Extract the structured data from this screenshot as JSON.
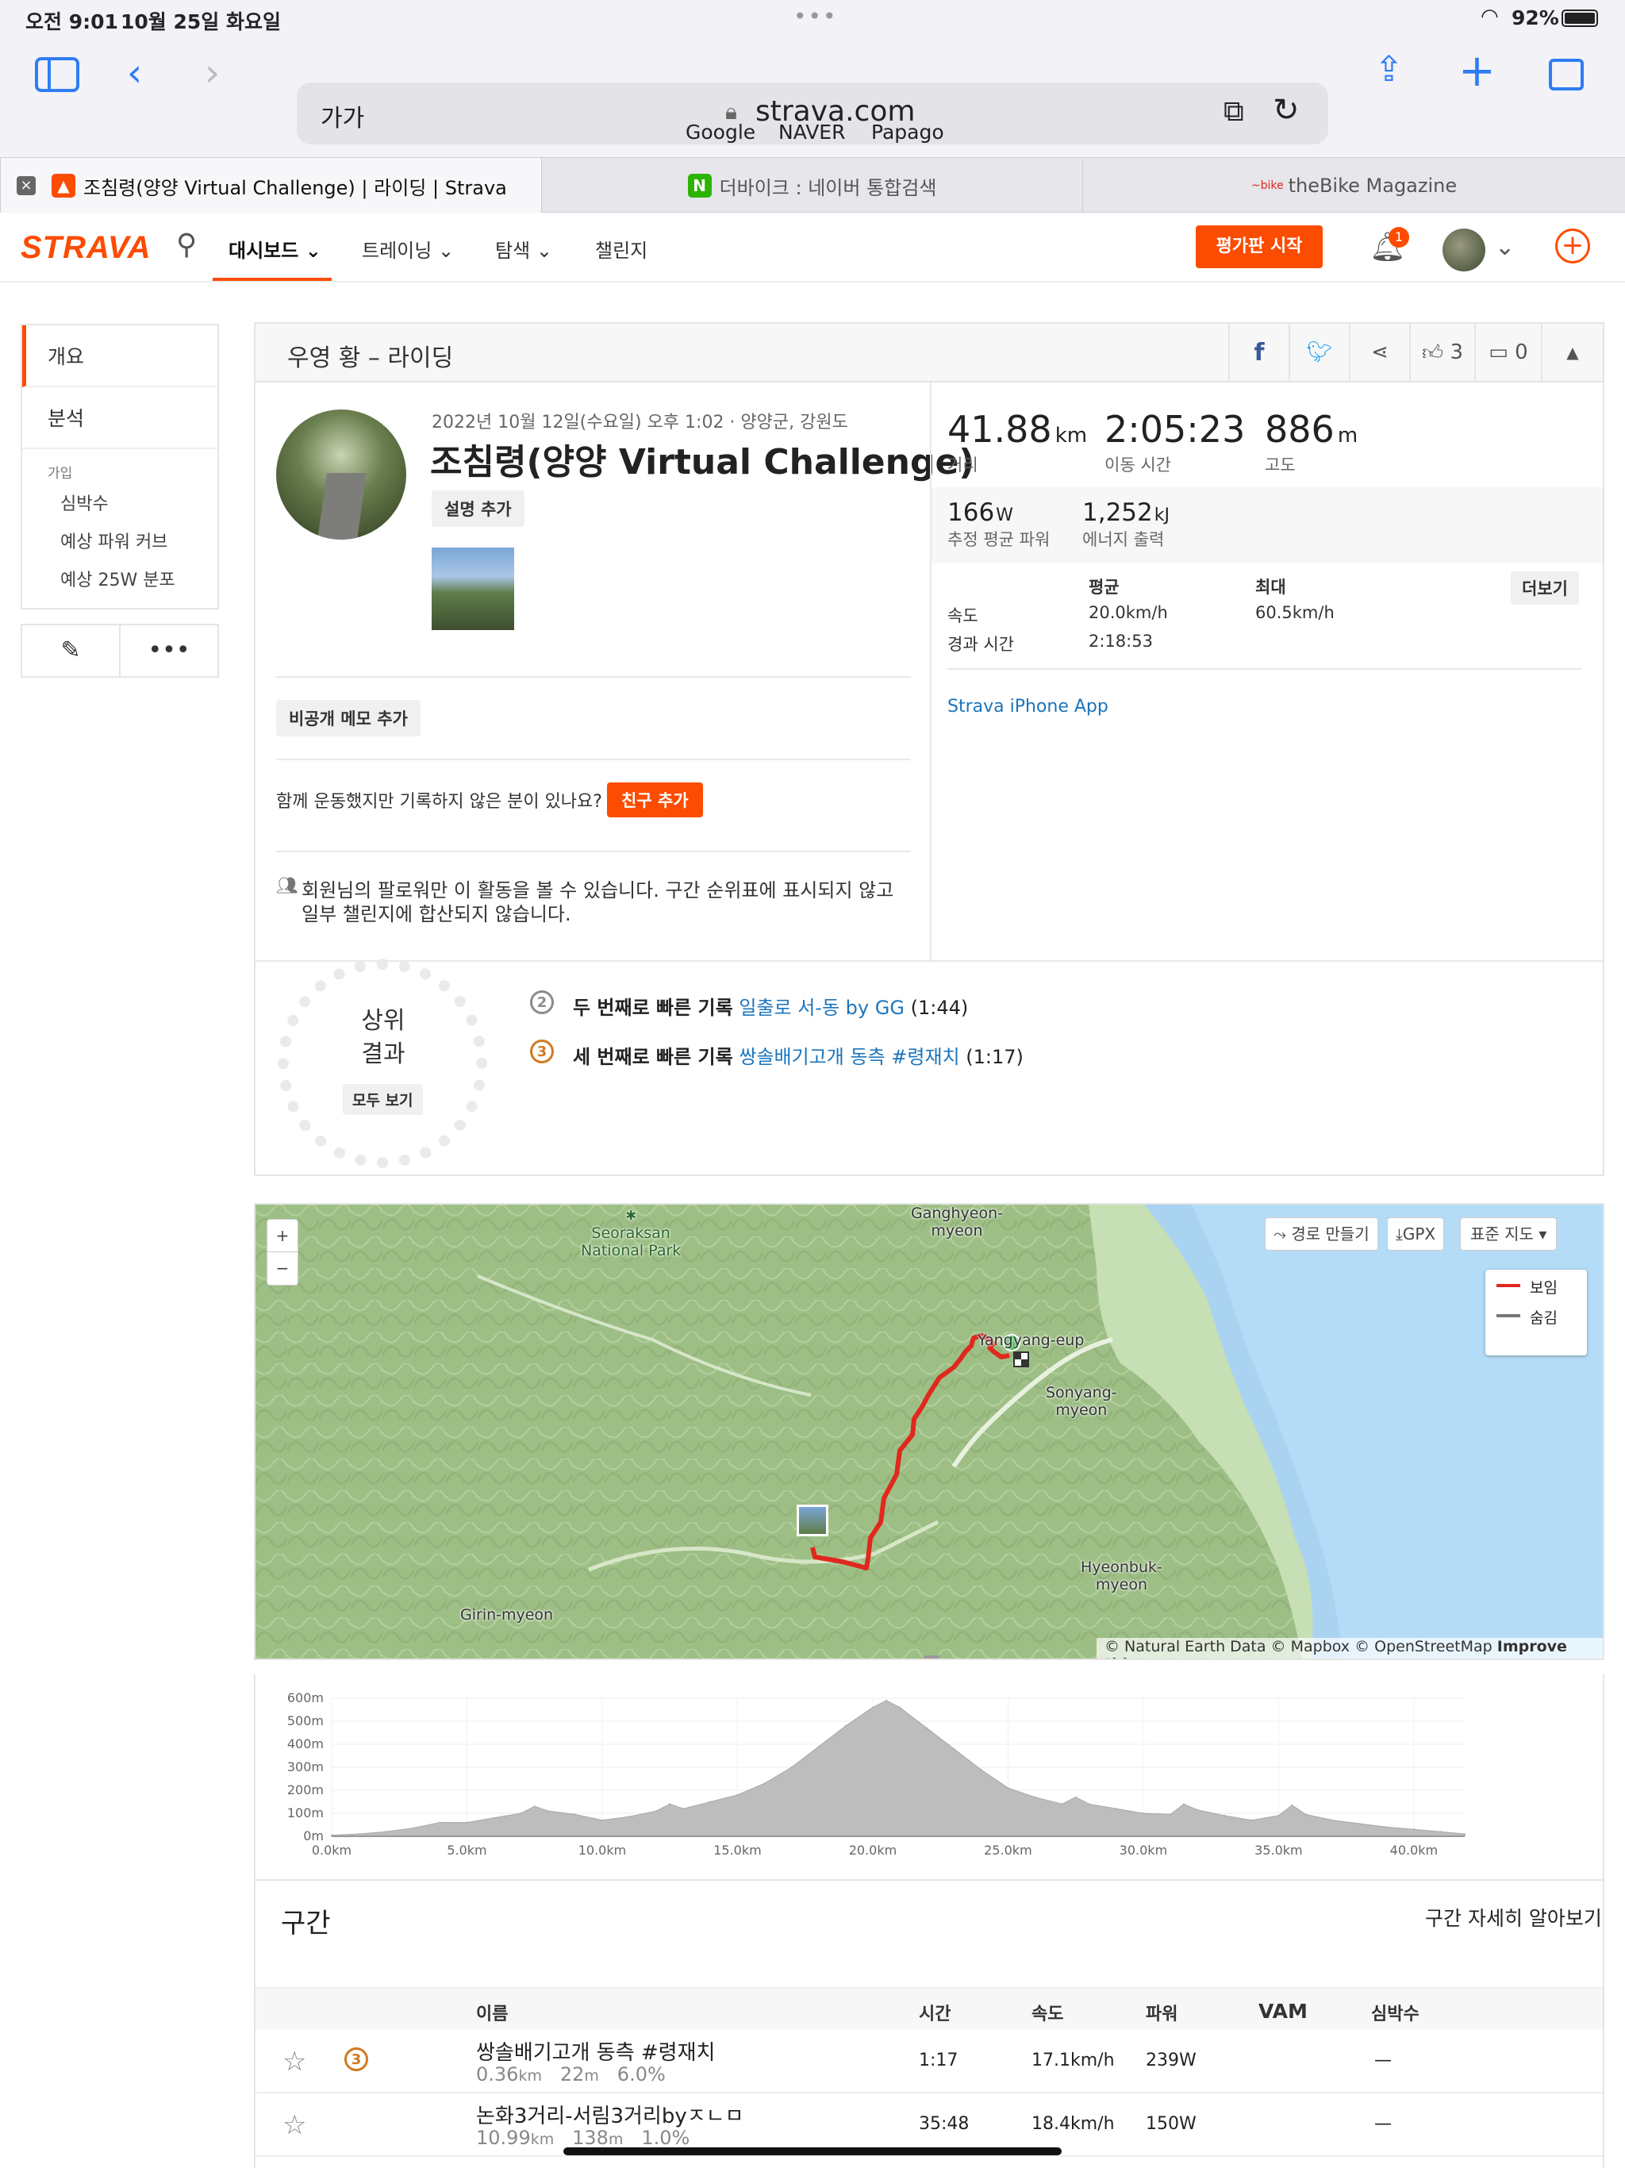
{
  "status": {
    "time": "오전 9:01",
    "date": "10월 25일 화요일",
    "battery": "92%"
  },
  "browser": {
    "url_text_size": "가가",
    "host": "strava.com",
    "favorites": [
      "Google",
      "NAVER",
      "Papago"
    ],
    "tabs": [
      {
        "title": "조침령(양양 Virtual Challenge) | 라이딩 | Strava",
        "active": true
      },
      {
        "title": "더바이크 : 네이버 통합검색",
        "active": false
      },
      {
        "title": "theBike Magazine",
        "active": false
      }
    ]
  },
  "nav": {
    "logo": "STRAVA",
    "items": [
      "대시보드",
      "트레이닝",
      "탐색",
      "챌린지"
    ],
    "cta": "평가판 시작",
    "notif_count": "1"
  },
  "sidebar": {
    "items": [
      "개요",
      "분석"
    ],
    "section": "가입",
    "sub": [
      "심박수",
      "예상 파워 커브",
      "예상 25W 분포"
    ]
  },
  "activity": {
    "header": "우영 황 – 라이딩",
    "kudos": "3",
    "comments": "0",
    "meta": "2022년 10월 12일(수요일) 오후 1:02 · 양양군, 강원도",
    "title": "조침령(양양 Virtual Challenge)",
    "add_desc": "설명 추가",
    "private_note": "비공개 메모 추가",
    "friends_q": "함께 운동했지만 기록하지 않은 분이 있나요?",
    "add_friend": "친구 추가",
    "privacy": "회원님의 팔로워만 이 활동을 볼 수 있습니다. 구간 순위표에 표시되지 않고",
    "privacy2": "일부 챌린지에 합산되지 않습니다."
  },
  "stats": {
    "distance": {
      "value": "41.88",
      "unit": "km",
      "label": "거리"
    },
    "moving_time": {
      "value": "2:05:23",
      "label": "이동 시간"
    },
    "elevation": {
      "value": "886",
      "unit": "m",
      "label": "고도"
    },
    "power": {
      "value": "166",
      "unit": "W",
      "label": "추정 평균 파워"
    },
    "energy": {
      "value": "1,252",
      "unit": "kJ",
      "label": "에너지 출력"
    },
    "table": {
      "avg_h": "평균",
      "max_h": "최대",
      "more": "더보기",
      "speed_l": "속도",
      "speed_avg": "20.0km/h",
      "speed_max": "60.5km/h",
      "elapsed_l": "경과 시간",
      "elapsed_avg": "2:18:53"
    },
    "device": "Strava iPhone App"
  },
  "achievements": {
    "label_line1": "상위",
    "label_line2": "결과",
    "view_all": "모두 보기",
    "items": [
      {
        "medal": "2",
        "rank": "두 번째로 빠른 기록",
        "segment": "일출로 서-동 by GG",
        "time": "(1:44)"
      },
      {
        "medal": "3",
        "rank": "세 번째로 빠른 기록",
        "segment": "쌍솔배기고개 동측 #령재치",
        "time": "(1:17)"
      }
    ]
  },
  "map": {
    "zoom_in": "+",
    "zoom_out": "−",
    "route_btn": "경로 만들기",
    "gpx_btn": "GPX",
    "style_btn": "표준 지도",
    "legend_show": "보임",
    "legend_hide": "숨김",
    "labels": {
      "seorak": "Seoraksan\nNational Park",
      "ganghyeon": "Ganghyeon-\nmyeon",
      "yangyang": "Yangyang-eup",
      "sonyang": "Sonyang-\nmyeon",
      "hyeonbuk": "Hyeonbuk-\nmyeon",
      "girin": "Girin-myeon"
    },
    "attribution": "© Natural Earth Data © Mapbox © OpenStreetMap",
    "improve": "Improve this map",
    "route_color": "#e0281e",
    "start_color": "#3bb54a"
  },
  "chart_data": {
    "type": "area",
    "y_ticks": [
      "600m",
      "500m",
      "400m",
      "300m",
      "200m",
      "100m",
      "0m"
    ],
    "x_ticks": [
      "0.0km",
      "5.0km",
      "10.0km",
      "15.0km",
      "20.0km",
      "25.0km",
      "30.0km",
      "35.0km",
      "40.0km"
    ],
    "ylim": [
      0,
      600
    ],
    "xlim": [
      0,
      41.88
    ],
    "x": [
      0,
      1,
      2,
      3,
      4,
      5,
      6,
      7,
      7.5,
      8,
      9,
      10,
      11,
      12,
      12.5,
      13,
      14,
      15,
      16,
      17,
      18,
      19,
      20,
      20.5,
      21,
      22,
      23,
      24,
      25,
      26,
      27,
      27.5,
      28,
      29,
      30,
      31,
      31.5,
      32,
      33,
      34,
      35,
      35.5,
      36,
      37,
      38,
      39,
      40,
      41,
      41.88
    ],
    "y": [
      5,
      10,
      20,
      35,
      60,
      60,
      80,
      100,
      130,
      110,
      95,
      70,
      85,
      110,
      140,
      120,
      150,
      180,
      230,
      300,
      390,
      480,
      560,
      590,
      560,
      470,
      380,
      290,
      210,
      170,
      140,
      170,
      140,
      120,
      100,
      95,
      140,
      115,
      90,
      70,
      90,
      135,
      95,
      70,
      55,
      40,
      30,
      20,
      10
    ]
  },
  "segments": {
    "title": "구간",
    "details_link": "구간 자세히 알아보기",
    "columns": [
      "이름",
      "시간",
      "속도",
      "파워",
      "VAM",
      "심박수"
    ],
    "rows": [
      {
        "star": "☆",
        "medal": "3",
        "name": "쌍솔배기고개 동측 #령재치",
        "dist": "0.36",
        "dist_u": "km",
        "elev": "22",
        "elev_u": "m",
        "grade": "6.0%",
        "time": "1:17",
        "speed": "17.1km/h",
        "power": "239W",
        "vam": "",
        "hr": "—"
      },
      {
        "star": "☆",
        "medal": "",
        "name": "논화3거리-서림3거리byㅈㄴㅁ",
        "dist": "10.99",
        "dist_u": "km",
        "elev": "138",
        "elev_u": "m",
        "grade": "1.0%",
        "time": "35:48",
        "speed": "18.4km/h",
        "power": "150W",
        "vam": "",
        "hr": "—"
      }
    ]
  }
}
